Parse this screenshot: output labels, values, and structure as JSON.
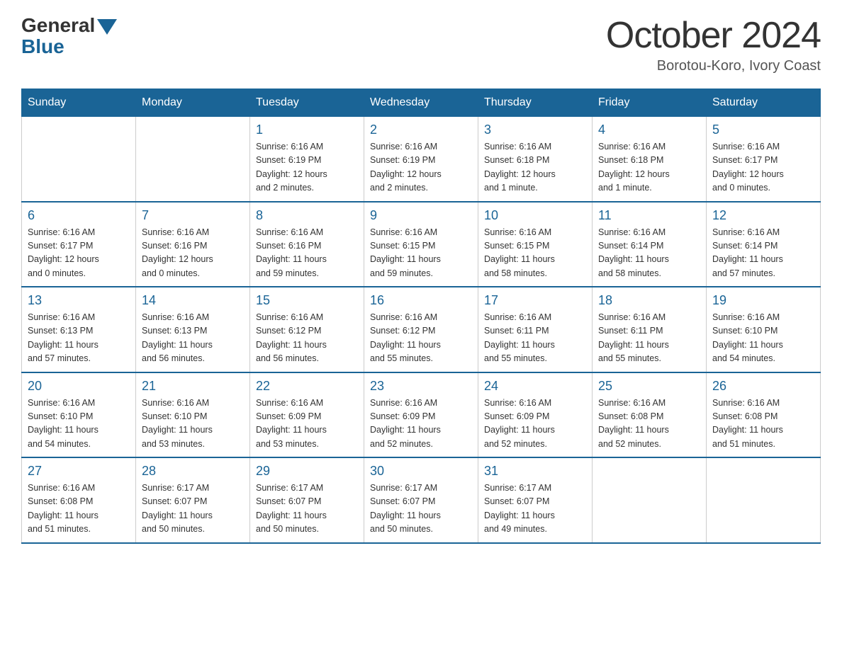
{
  "header": {
    "logo_general": "General",
    "logo_blue": "Blue",
    "month_title": "October 2024",
    "location": "Borotou-Koro, Ivory Coast"
  },
  "days_of_week": [
    "Sunday",
    "Monday",
    "Tuesday",
    "Wednesday",
    "Thursday",
    "Friday",
    "Saturday"
  ],
  "weeks": [
    [
      {
        "day": "",
        "info": ""
      },
      {
        "day": "",
        "info": ""
      },
      {
        "day": "1",
        "info": "Sunrise: 6:16 AM\nSunset: 6:19 PM\nDaylight: 12 hours\nand 2 minutes."
      },
      {
        "day": "2",
        "info": "Sunrise: 6:16 AM\nSunset: 6:19 PM\nDaylight: 12 hours\nand 2 minutes."
      },
      {
        "day": "3",
        "info": "Sunrise: 6:16 AM\nSunset: 6:18 PM\nDaylight: 12 hours\nand 1 minute."
      },
      {
        "day": "4",
        "info": "Sunrise: 6:16 AM\nSunset: 6:18 PM\nDaylight: 12 hours\nand 1 minute."
      },
      {
        "day": "5",
        "info": "Sunrise: 6:16 AM\nSunset: 6:17 PM\nDaylight: 12 hours\nand 0 minutes."
      }
    ],
    [
      {
        "day": "6",
        "info": "Sunrise: 6:16 AM\nSunset: 6:17 PM\nDaylight: 12 hours\nand 0 minutes."
      },
      {
        "day": "7",
        "info": "Sunrise: 6:16 AM\nSunset: 6:16 PM\nDaylight: 12 hours\nand 0 minutes."
      },
      {
        "day": "8",
        "info": "Sunrise: 6:16 AM\nSunset: 6:16 PM\nDaylight: 11 hours\nand 59 minutes."
      },
      {
        "day": "9",
        "info": "Sunrise: 6:16 AM\nSunset: 6:15 PM\nDaylight: 11 hours\nand 59 minutes."
      },
      {
        "day": "10",
        "info": "Sunrise: 6:16 AM\nSunset: 6:15 PM\nDaylight: 11 hours\nand 58 minutes."
      },
      {
        "day": "11",
        "info": "Sunrise: 6:16 AM\nSunset: 6:14 PM\nDaylight: 11 hours\nand 58 minutes."
      },
      {
        "day": "12",
        "info": "Sunrise: 6:16 AM\nSunset: 6:14 PM\nDaylight: 11 hours\nand 57 minutes."
      }
    ],
    [
      {
        "day": "13",
        "info": "Sunrise: 6:16 AM\nSunset: 6:13 PM\nDaylight: 11 hours\nand 57 minutes."
      },
      {
        "day": "14",
        "info": "Sunrise: 6:16 AM\nSunset: 6:13 PM\nDaylight: 11 hours\nand 56 minutes."
      },
      {
        "day": "15",
        "info": "Sunrise: 6:16 AM\nSunset: 6:12 PM\nDaylight: 11 hours\nand 56 minutes."
      },
      {
        "day": "16",
        "info": "Sunrise: 6:16 AM\nSunset: 6:12 PM\nDaylight: 11 hours\nand 55 minutes."
      },
      {
        "day": "17",
        "info": "Sunrise: 6:16 AM\nSunset: 6:11 PM\nDaylight: 11 hours\nand 55 minutes."
      },
      {
        "day": "18",
        "info": "Sunrise: 6:16 AM\nSunset: 6:11 PM\nDaylight: 11 hours\nand 55 minutes."
      },
      {
        "day": "19",
        "info": "Sunrise: 6:16 AM\nSunset: 6:10 PM\nDaylight: 11 hours\nand 54 minutes."
      }
    ],
    [
      {
        "day": "20",
        "info": "Sunrise: 6:16 AM\nSunset: 6:10 PM\nDaylight: 11 hours\nand 54 minutes."
      },
      {
        "day": "21",
        "info": "Sunrise: 6:16 AM\nSunset: 6:10 PM\nDaylight: 11 hours\nand 53 minutes."
      },
      {
        "day": "22",
        "info": "Sunrise: 6:16 AM\nSunset: 6:09 PM\nDaylight: 11 hours\nand 53 minutes."
      },
      {
        "day": "23",
        "info": "Sunrise: 6:16 AM\nSunset: 6:09 PM\nDaylight: 11 hours\nand 52 minutes."
      },
      {
        "day": "24",
        "info": "Sunrise: 6:16 AM\nSunset: 6:09 PM\nDaylight: 11 hours\nand 52 minutes."
      },
      {
        "day": "25",
        "info": "Sunrise: 6:16 AM\nSunset: 6:08 PM\nDaylight: 11 hours\nand 52 minutes."
      },
      {
        "day": "26",
        "info": "Sunrise: 6:16 AM\nSunset: 6:08 PM\nDaylight: 11 hours\nand 51 minutes."
      }
    ],
    [
      {
        "day": "27",
        "info": "Sunrise: 6:16 AM\nSunset: 6:08 PM\nDaylight: 11 hours\nand 51 minutes."
      },
      {
        "day": "28",
        "info": "Sunrise: 6:17 AM\nSunset: 6:07 PM\nDaylight: 11 hours\nand 50 minutes."
      },
      {
        "day": "29",
        "info": "Sunrise: 6:17 AM\nSunset: 6:07 PM\nDaylight: 11 hours\nand 50 minutes."
      },
      {
        "day": "30",
        "info": "Sunrise: 6:17 AM\nSunset: 6:07 PM\nDaylight: 11 hours\nand 50 minutes."
      },
      {
        "day": "31",
        "info": "Sunrise: 6:17 AM\nSunset: 6:07 PM\nDaylight: 11 hours\nand 49 minutes."
      },
      {
        "day": "",
        "info": ""
      },
      {
        "day": "",
        "info": ""
      }
    ]
  ]
}
